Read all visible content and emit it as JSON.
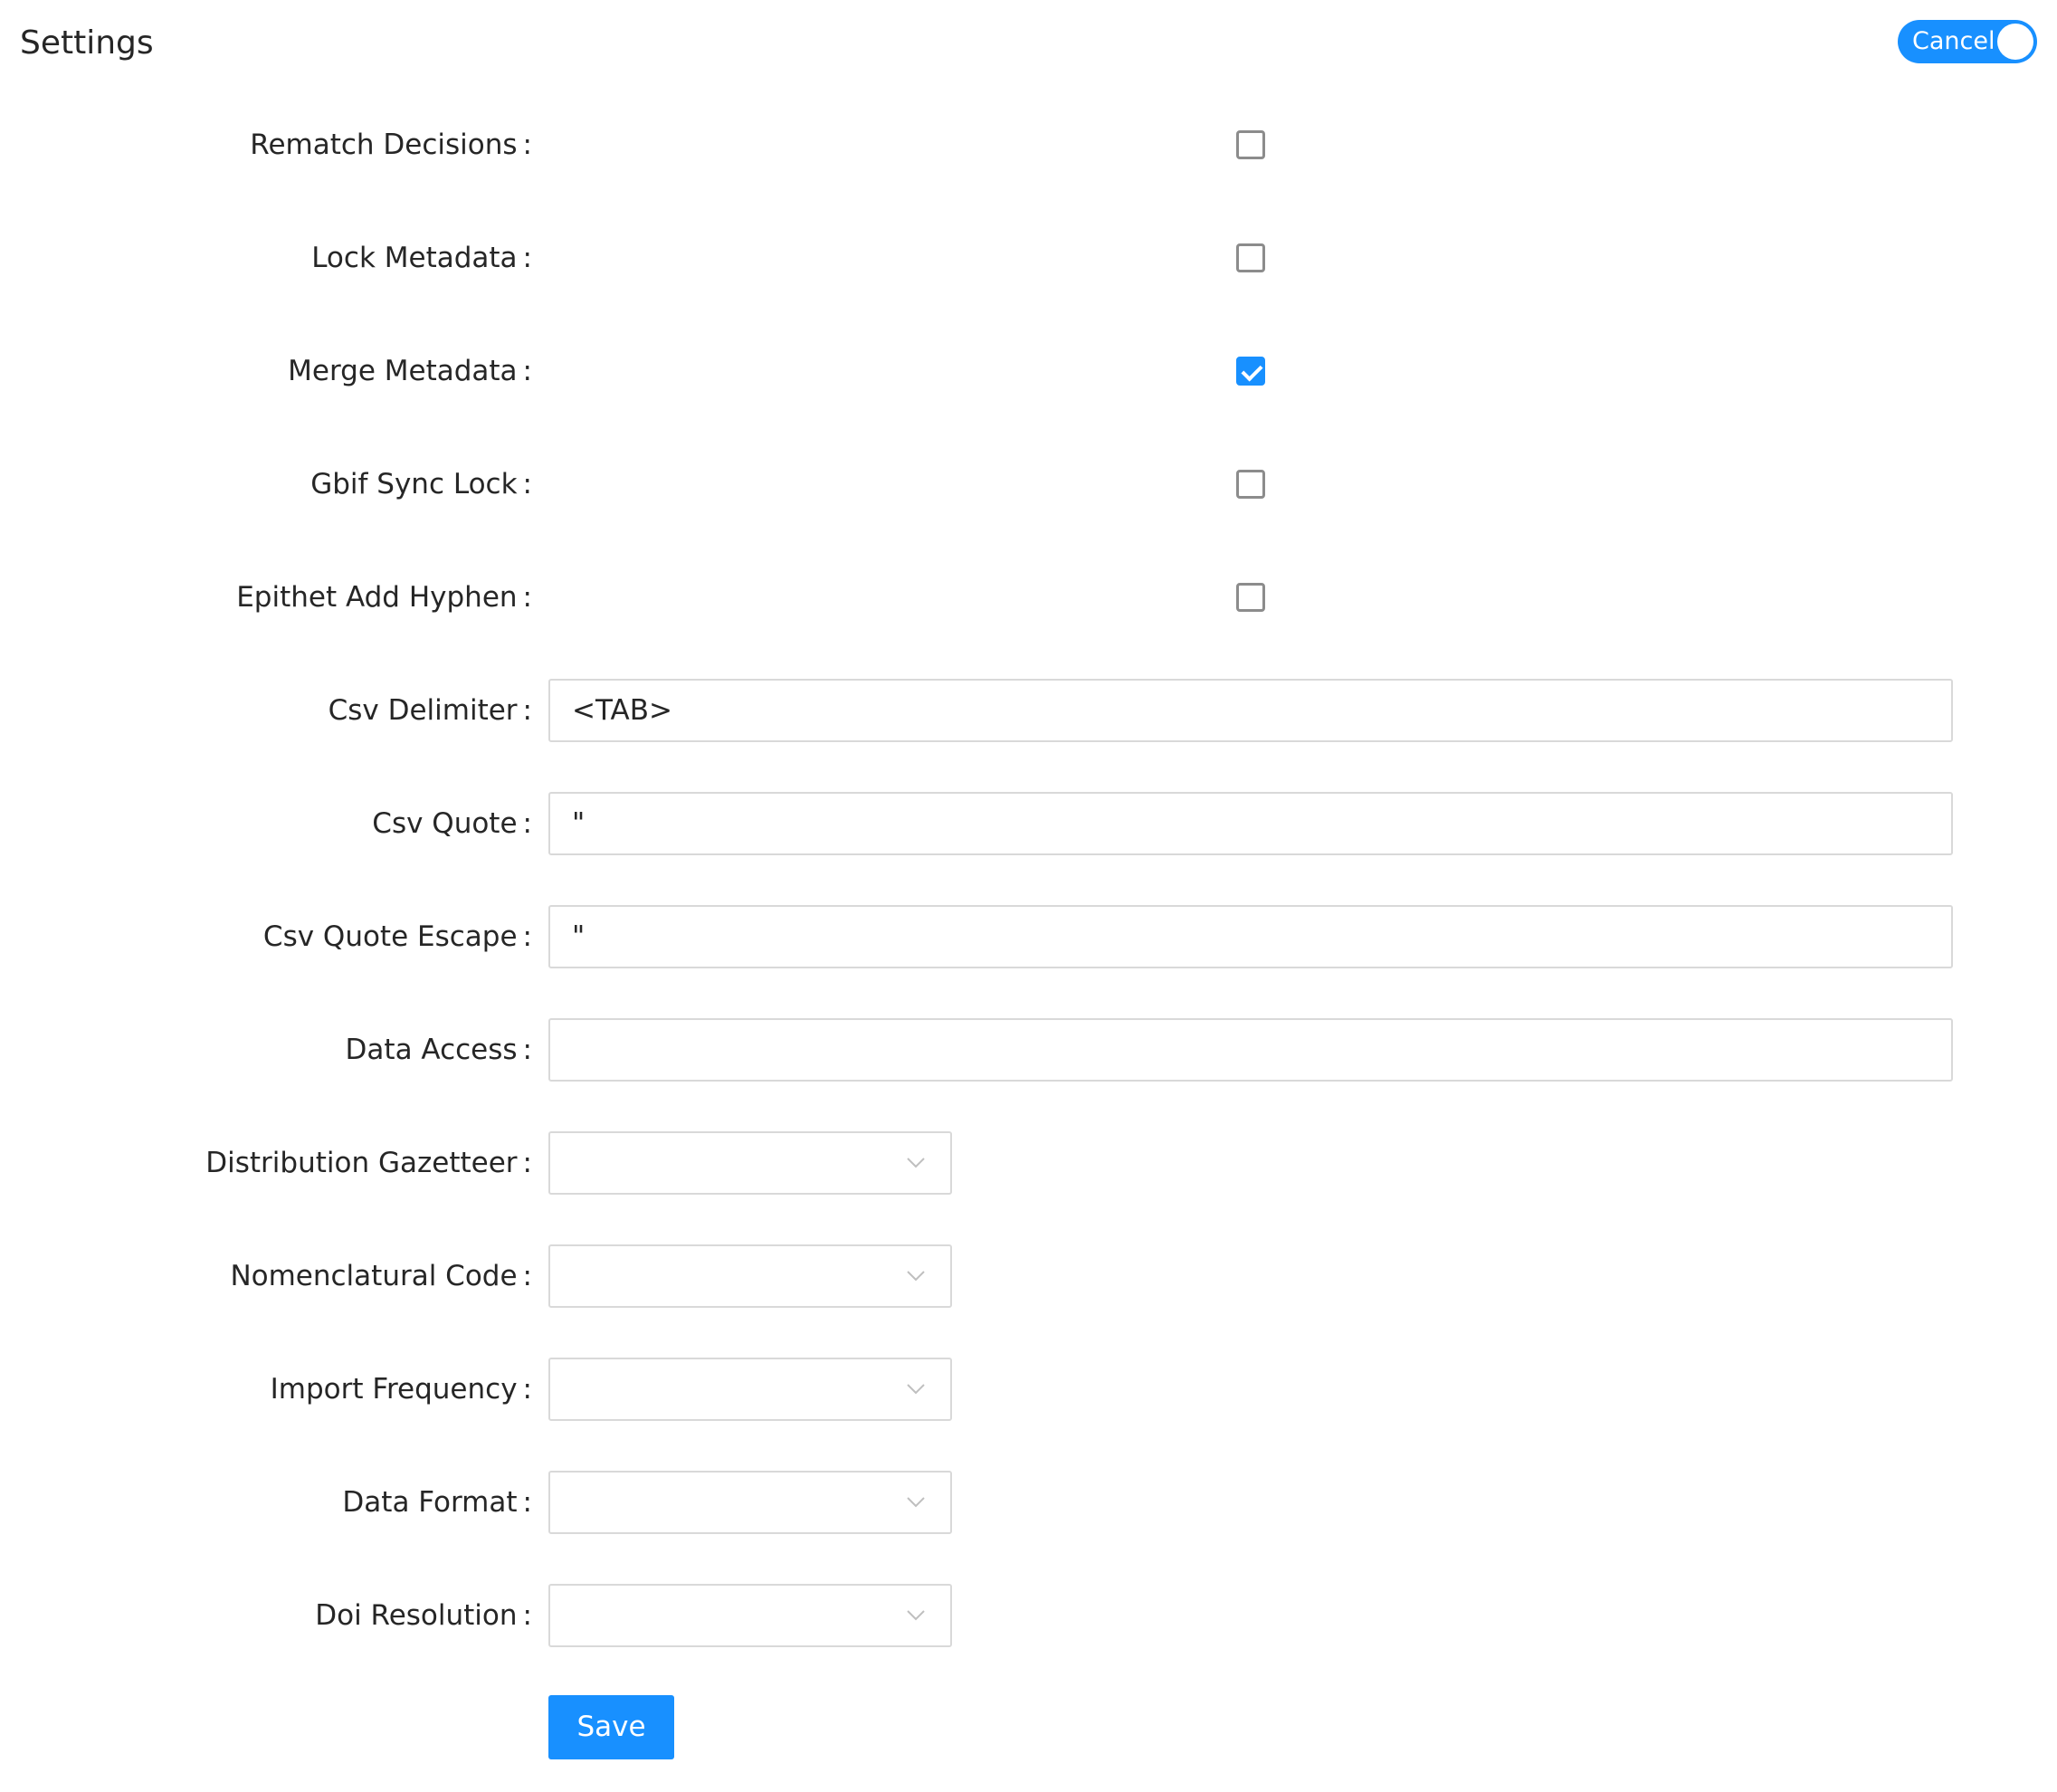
{
  "header": {
    "title": "Settings",
    "toggle_label": "Cancel"
  },
  "form": {
    "colon": ":",
    "rematch_decisions": {
      "label": "Rematch Decisions",
      "checked": false
    },
    "lock_metadata": {
      "label": "Lock Metadata",
      "checked": false
    },
    "merge_metadata": {
      "label": "Merge Metadata",
      "checked": true
    },
    "gbif_sync_lock": {
      "label": "Gbif Sync Lock",
      "checked": false
    },
    "epithet_add_hyphen": {
      "label": "Epithet Add Hyphen",
      "checked": false
    },
    "csv_delimiter": {
      "label": "Csv Delimiter",
      "value": "<TAB>"
    },
    "csv_quote": {
      "label": "Csv Quote",
      "value": "\""
    },
    "csv_quote_escape": {
      "label": "Csv Quote Escape",
      "value": "\""
    },
    "data_access": {
      "label": "Data Access",
      "value": ""
    },
    "distribution_gazetteer": {
      "label": "Distribution Gazetteer",
      "value": ""
    },
    "nomenclatural_code": {
      "label": "Nomenclatural Code",
      "value": ""
    },
    "import_frequency": {
      "label": "Import Frequency",
      "value": ""
    },
    "data_format": {
      "label": "Data Format",
      "value": ""
    },
    "doi_resolution": {
      "label": "Doi Resolution",
      "value": ""
    },
    "save_label": "Save"
  },
  "colors": {
    "primary": "#1890ff",
    "border": "#d9d9d9",
    "text": "#262626"
  },
  "icons": {
    "select_arrow": "chevron-down-icon",
    "check": "checkmark-icon"
  }
}
